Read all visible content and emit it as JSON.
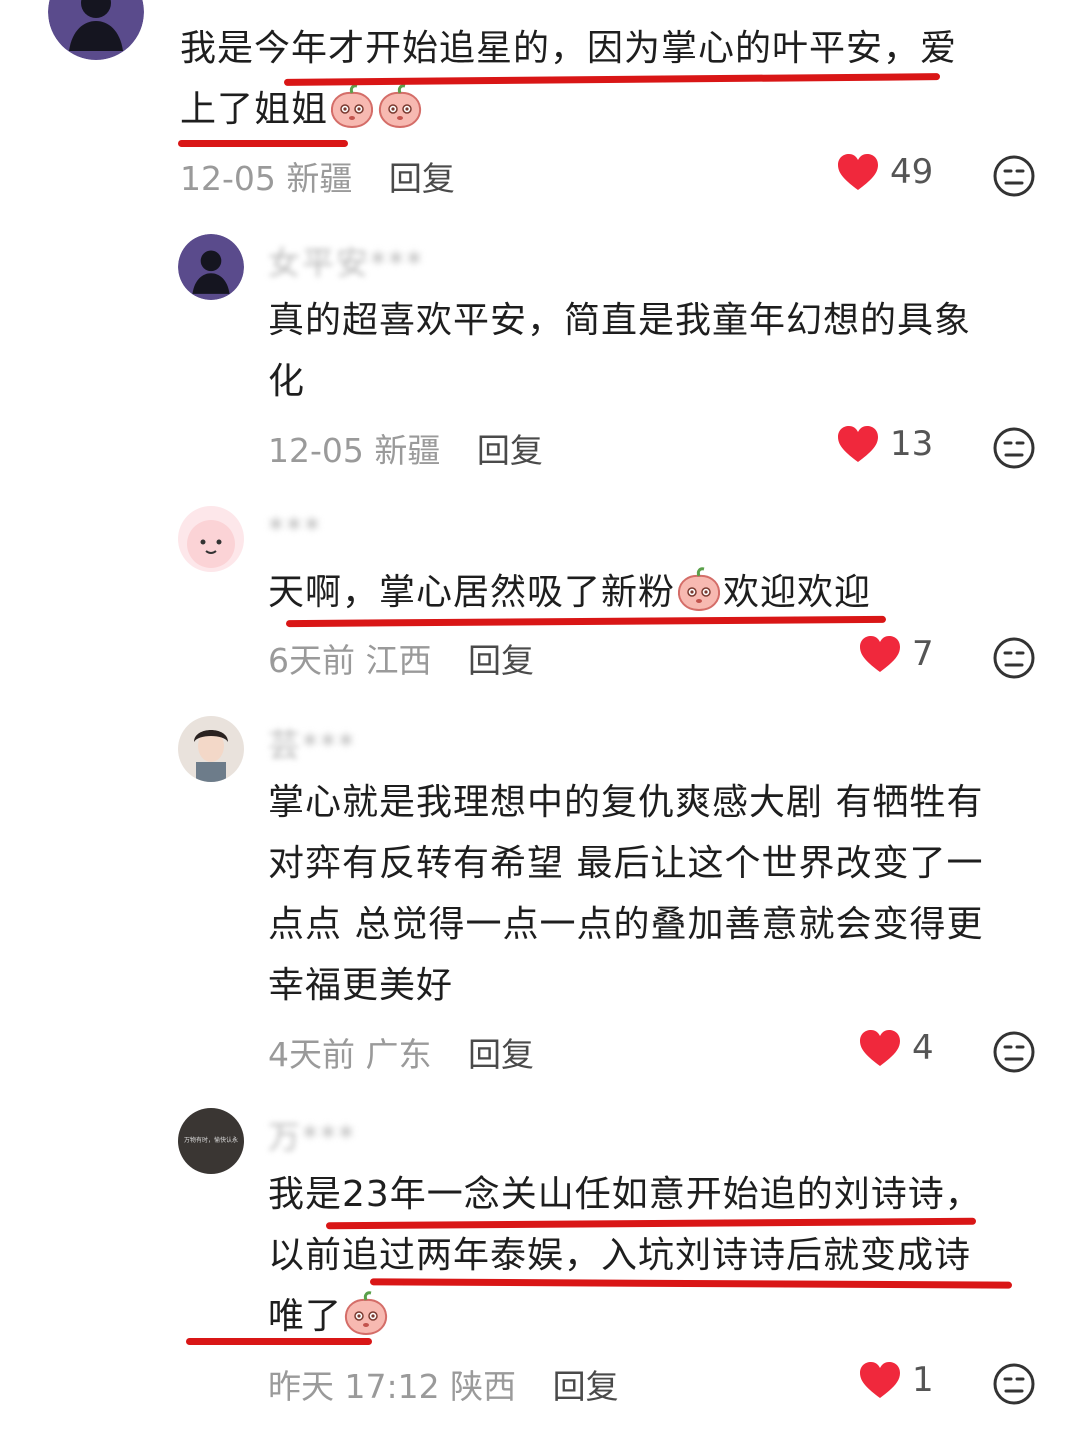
{
  "comments": [
    {
      "username": "",
      "text_line1": "我是今年才开始追星的，因为掌心的叶平安，爱",
      "text_line2": "上了姐姐",
      "date": "12-05",
      "location": "新疆",
      "reply_label": "回复",
      "likes": "49"
    },
    {
      "username": "女平安***",
      "text_line1": "真的超喜欢平安，简直是我童年幻想的具象",
      "text_line2": "化",
      "date": "12-05",
      "location": "新疆",
      "reply_label": "回复",
      "likes": "13"
    },
    {
      "username": "***",
      "text_line1a": "天啊，掌心居然吸了新粉",
      "text_line1b": "欢迎欢迎",
      "date": "6天前",
      "location": "江西",
      "reply_label": "回复",
      "likes": "7"
    },
    {
      "username": "芸***",
      "text_line1": "掌心就是我理想中的复仇爽感大剧 有牺牲有",
      "text_line2": "对弈有反转有希望 最后让这个世界改变了一",
      "text_line3": "点点 总觉得一点一点的叠加善意就会变得更",
      "text_line4": "幸福更美好",
      "date": "4天前",
      "location": "广东",
      "reply_label": "回复",
      "likes": "4"
    },
    {
      "username": "万***",
      "avatar_text": "万物有时，愉快认永",
      "text_line1": "我是23年一念关山任如意开始追的刘诗诗，",
      "text_line2": "以前追过两年泰娱，入坑刘诗诗后就变成诗",
      "text_line3": "唯了",
      "date": "昨天 17:12",
      "location": "陕西",
      "reply_label": "回复",
      "likes": "1"
    }
  ],
  "icons": {
    "like": "heart-icon",
    "dislike": "dislike-face-icon",
    "emoji": "peach-emoji-icon"
  },
  "colors": {
    "heart": "#f0283c",
    "underline": "#d91616",
    "meta_text": "#9a9a9a"
  }
}
